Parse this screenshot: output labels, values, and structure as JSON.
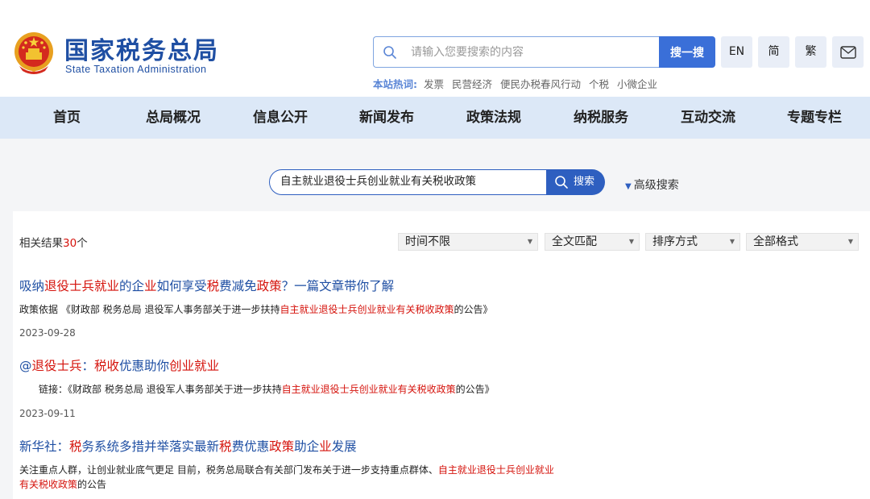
{
  "header": {
    "title": "国家税务总局",
    "subtitle": "State Taxation Administration",
    "search_placeholder": "请输入您要搜索的内容",
    "search_button": "搜一搜",
    "lang_buttons": [
      "EN",
      "简",
      "繁"
    ],
    "hot_label": "本站热词:",
    "hot_words": [
      "发票",
      "民营经济",
      "便民办税春风行动",
      "个税",
      "小微企业"
    ]
  },
  "nav": {
    "items": [
      "首页",
      "总局概况",
      "信息公开",
      "新闻发布",
      "政策法规",
      "纳税服务",
      "互动交流",
      "专题专栏"
    ]
  },
  "search": {
    "query": "自主就业退役士兵创业就业有关税收政策",
    "button": "搜索",
    "advanced": "高级搜索"
  },
  "results_bar": {
    "prefix": "相关结果",
    "count": "30",
    "suffix": "个",
    "filters": [
      "时间不限",
      "全文匹配",
      "排序方式",
      "全部格式"
    ]
  },
  "results": [
    {
      "title_parts": [
        {
          "t": "吸纳",
          "hl": false
        },
        {
          "t": "退役士兵就业",
          "hl": true
        },
        {
          "t": "的企",
          "hl": false
        },
        {
          "t": "业",
          "hl": true
        },
        {
          "t": "如何享受",
          "hl": false
        },
        {
          "t": "税",
          "hl": true
        },
        {
          "t": "费减免",
          "hl": false
        },
        {
          "t": "政策",
          "hl": true
        },
        {
          "t": "？一篇文章带你了解",
          "hl": false
        }
      ],
      "snippet_parts": [
        {
          "t": "政策依据 《财政部 税务总局 退役军人事务部关于进一步扶持",
          "hl": false
        },
        {
          "t": "自主就业退役士兵创业就业有关税收政策",
          "hl": true
        },
        {
          "t": "的公告》",
          "hl": false
        }
      ],
      "date": "2023-09-28"
    },
    {
      "title_parts": [
        {
          "t": "@",
          "hl": false
        },
        {
          "t": "退役士兵",
          "hl": true
        },
        {
          "t": "：",
          "hl": false
        },
        {
          "t": "税收",
          "hl": true
        },
        {
          "t": "优惠助你",
          "hl": false
        },
        {
          "t": "创业就业",
          "hl": true
        }
      ],
      "snippet_parts": [
        {
          "t": "链接：《财政部 税务总局 退役军人事务部关于进一步扶持",
          "hl": false
        },
        {
          "t": "自主就业退役士兵创业就业有关税收政策",
          "hl": true
        },
        {
          "t": "的公告》",
          "hl": false
        }
      ],
      "date": "2023-09-11"
    },
    {
      "title_parts": [
        {
          "t": "新华社：",
          "hl": false
        },
        {
          "t": "税",
          "hl": true
        },
        {
          "t": "务系统多措并举落实最新",
          "hl": false
        },
        {
          "t": "税",
          "hl": true
        },
        {
          "t": "费优惠",
          "hl": false
        },
        {
          "t": "政策",
          "hl": true
        },
        {
          "t": "助企",
          "hl": false
        },
        {
          "t": "业",
          "hl": true
        },
        {
          "t": "发展",
          "hl": false
        }
      ],
      "snippet_line1": [
        {
          "t": "关注重点人群，让创业就业底气更足 目前，税务总局联合有关部门发布关于进一步支持重点群体、",
          "hl": false
        },
        {
          "t": "自主就业退役士兵创业就业",
          "hl": true
        }
      ],
      "snippet_line2": [
        {
          "t": "有关税收政策",
          "hl": true
        },
        {
          "t": "的公告",
          "hl": false
        }
      ]
    }
  ],
  "colors": {
    "brand_blue": "#1f4fa3",
    "highlight_red": "#d5130c",
    "nav_bg": "#dce8f7",
    "button_blue": "#3a6fd8"
  }
}
